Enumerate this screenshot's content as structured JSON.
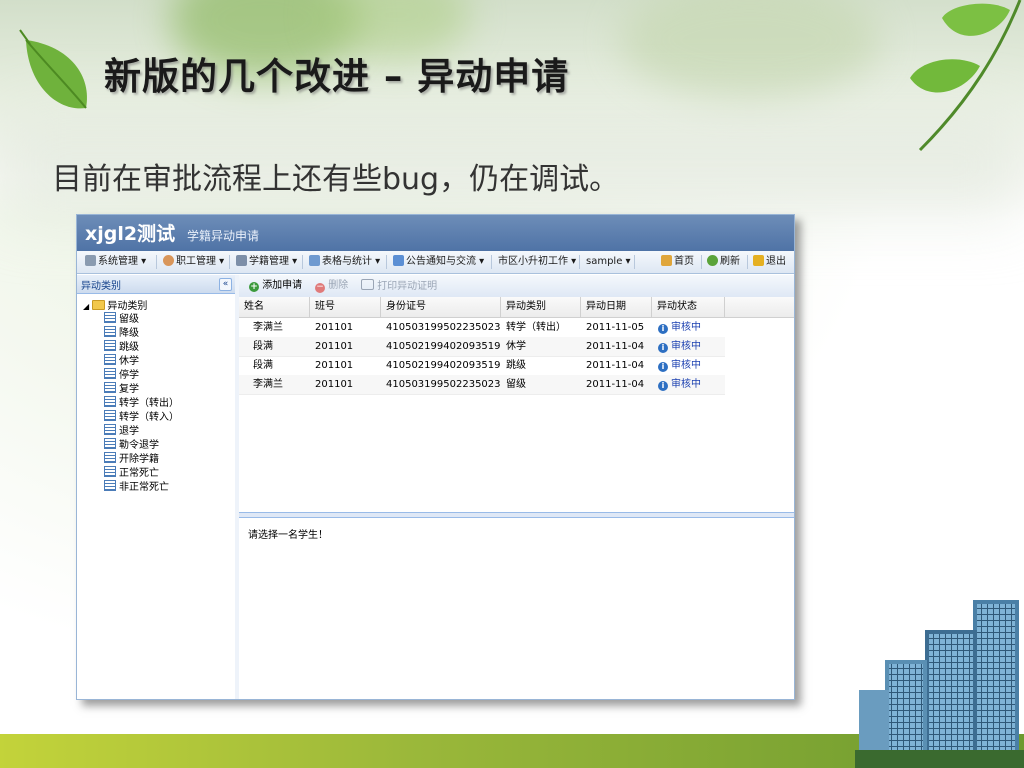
{
  "slide": {
    "title": "新版的几个改进 – 异动申请",
    "subtitle": "目前在审批流程上还有些bug，仍在调试。"
  },
  "app": {
    "title": "xjgl2测试",
    "subtitle": "学籍异动申请"
  },
  "menu": {
    "items": [
      {
        "label": "系统管理 ▾",
        "icon": "wrench-icon"
      },
      {
        "label": "职工管理 ▾",
        "icon": "user-icon"
      },
      {
        "label": "学籍管理 ▾",
        "icon": "student-icon"
      },
      {
        "label": "表格与统计 ▾",
        "icon": "table-icon"
      },
      {
        "label": "公告通知与交流 ▾",
        "icon": "notice-icon"
      },
      {
        "label": "市区小升初工作 ▾",
        "icon": ""
      },
      {
        "label": "sample ▾",
        "icon": ""
      }
    ],
    "right_items": [
      {
        "label": "首页",
        "icon": "home-icon"
      },
      {
        "label": "刷新",
        "icon": "refresh-icon"
      },
      {
        "label": "退出",
        "icon": "exit-icon"
      }
    ]
  },
  "left_panel": {
    "title": "异动类别",
    "collapse_glyph": "«",
    "tree_root": "异动类别",
    "items": [
      "留级",
      "降级",
      "跳级",
      "休学",
      "停学",
      "复学",
      "转学（转出）",
      "转学（转入）",
      "退学",
      "勒令退学",
      "开除学籍",
      "正常死亡",
      "非正常死亡"
    ]
  },
  "toolbar": {
    "add_label": "添加申请",
    "delete_label": "删除",
    "print_label": "打印异动证明"
  },
  "grid": {
    "columns": [
      "姓名",
      "班号",
      "身份证号",
      "异动类别",
      "异动日期",
      "异动状态"
    ],
    "rows": [
      {
        "name": "李满兰",
        "class": "201101",
        "id": "410503199502235023",
        "type": "转学（转出）",
        "date": "2011-11-05",
        "status": "审核中"
      },
      {
        "name": "段满",
        "class": "201101",
        "id": "410502199402093519",
        "type": "休学",
        "date": "2011-11-04",
        "status": "审核中"
      },
      {
        "name": "段满",
        "class": "201101",
        "id": "410502199402093519",
        "type": "跳级",
        "date": "2011-11-04",
        "status": "审核中"
      },
      {
        "name": "李满兰",
        "class": "201101",
        "id": "410503199502235023",
        "type": "留级",
        "date": "2011-11-04",
        "status": "审核中"
      }
    ]
  },
  "detail": {
    "message": "请选择一名学生！"
  },
  "colors": {
    "header_blue": "#4f73a6",
    "status_blue": "#1a3fb0",
    "bottom_green": "#9bb83a"
  }
}
